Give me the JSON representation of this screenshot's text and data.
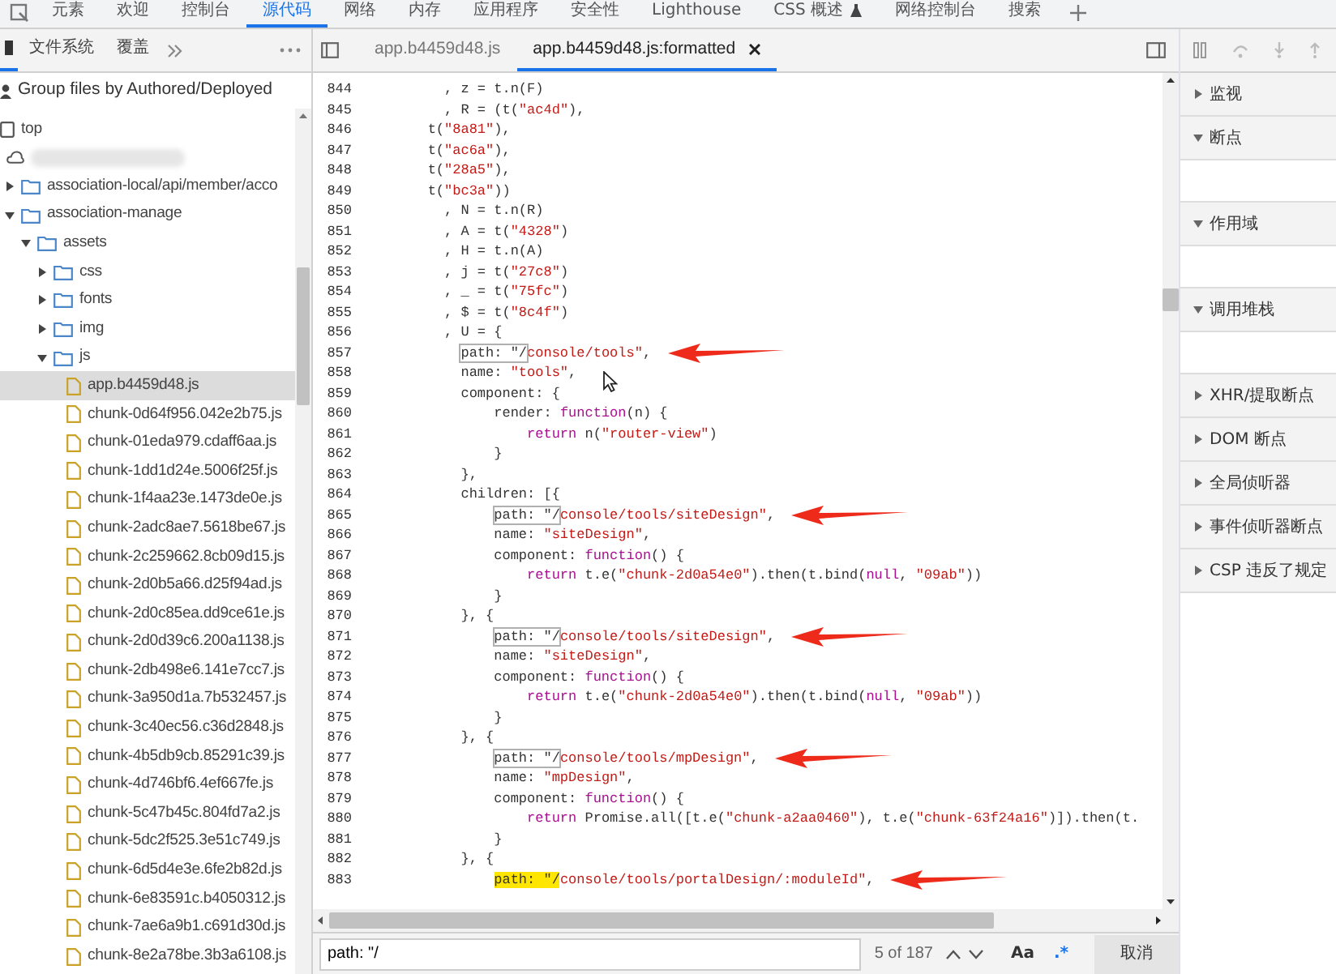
{
  "top_tabs": [
    {
      "label": "元素",
      "selected": false
    },
    {
      "label": "欢迎",
      "selected": false
    },
    {
      "label": "控制台",
      "selected": false
    },
    {
      "label": "源代码",
      "selected": true
    },
    {
      "label": "网络",
      "selected": false
    },
    {
      "label": "内存",
      "selected": false
    },
    {
      "label": "应用程序",
      "selected": false
    },
    {
      "label": "安全性",
      "selected": false
    },
    {
      "label": "Lighthouse",
      "selected": false
    },
    {
      "label": "CSS 概述",
      "selected": false,
      "has_icon": true
    },
    {
      "label": "网络控制台",
      "selected": false
    },
    {
      "label": "搜索",
      "selected": false
    }
  ],
  "navigator": {
    "tabs": [
      {
        "selected": true
      },
      {
        "label": "文件系统",
        "selected": false
      },
      {
        "label": "覆盖",
        "selected": false
      }
    ],
    "group_label": "Group files by Authored/Deployed",
    "tree": [
      {
        "kind": "frame",
        "label": "top",
        "children": [
          {
            "kind": "cloud",
            "children": [
              {
                "kind": "folder",
                "label": "association-local/api/member/acco",
                "expanded": false
              },
              {
                "kind": "folder",
                "label": "association-manage",
                "expanded": true,
                "children": [
                  {
                    "kind": "folder",
                    "label": "assets",
                    "expanded": true,
                    "children": [
                      {
                        "kind": "folder",
                        "label": "css",
                        "expanded": false
                      },
                      {
                        "kind": "folder",
                        "label": "fonts",
                        "expanded": false
                      },
                      {
                        "kind": "folder",
                        "label": "img",
                        "expanded": false
                      },
                      {
                        "kind": "folder",
                        "label": "js",
                        "expanded": true,
                        "children": [
                          {
                            "kind": "file",
                            "label": "app.b4459d48.js",
                            "selected": true
                          },
                          {
                            "kind": "file",
                            "label": "chunk-0d64f956.042e2b75.js",
                            "selected": false
                          },
                          {
                            "kind": "file",
                            "label": "chunk-01eda979.cdaff6aa.js",
                            "selected": false
                          },
                          {
                            "kind": "file",
                            "label": "chunk-1dd1d24e.5006f25f.js",
                            "selected": false
                          },
                          {
                            "kind": "file",
                            "label": "chunk-1f4aa23e.1473de0e.js",
                            "selected": false
                          },
                          {
                            "kind": "file",
                            "label": "chunk-2adc8ae7.5618be67.js",
                            "selected": false
                          },
                          {
                            "kind": "file",
                            "label": "chunk-2c259662.8cb09d15.js",
                            "selected": false
                          },
                          {
                            "kind": "file",
                            "label": "chunk-2d0b5a66.d25f94ad.js",
                            "selected": false
                          },
                          {
                            "kind": "file",
                            "label": "chunk-2d0c85ea.dd9ce61e.js",
                            "selected": false
                          },
                          {
                            "kind": "file",
                            "label": "chunk-2d0d39c6.200a1138.js",
                            "selected": false
                          },
                          {
                            "kind": "file",
                            "label": "chunk-2db498e6.141e7cc7.js",
                            "selected": false
                          },
                          {
                            "kind": "file",
                            "label": "chunk-3a950d1a.7b532457.js",
                            "selected": false
                          },
                          {
                            "kind": "file",
                            "label": "chunk-3c40ec56.c36d2848.js",
                            "selected": false
                          },
                          {
                            "kind": "file",
                            "label": "chunk-4b5db9cb.85291c39.js",
                            "selected": false
                          },
                          {
                            "kind": "file",
                            "label": "chunk-4d746bf6.4ef667fe.js",
                            "selected": false
                          },
                          {
                            "kind": "file",
                            "label": "chunk-5c47b45c.804fd7a2.js",
                            "selected": false
                          },
                          {
                            "kind": "file",
                            "label": "chunk-5dc2f525.3e51c749.js",
                            "selected": false
                          },
                          {
                            "kind": "file",
                            "label": "chunk-6d5d4e3e.6fe2b82d.js",
                            "selected": false
                          },
                          {
                            "kind": "file",
                            "label": "chunk-6e83591c.b4050312.js",
                            "selected": false
                          },
                          {
                            "kind": "file",
                            "label": "chunk-7ae6a9b1.c691d30d.js",
                            "selected": false
                          },
                          {
                            "kind": "file",
                            "label": "chunk-8e2a78be.3b3a6108.js",
                            "selected": false
                          }
                        ]
                      }
                    ]
                  }
                ]
              }
            ]
          }
        ]
      }
    ]
  },
  "editor": {
    "tabs": [
      {
        "label": "app.b4459d48.js",
        "selected": false
      },
      {
        "label": "app.b4459d48.js:formatted",
        "selected": true,
        "closable": true
      }
    ],
    "lines": [
      {
        "num": "844",
        "segs": [
          {
            "kind": "plain",
            "text": "          , z = t.n(F)"
          }
        ]
      },
      {
        "num": "845",
        "segs": [
          {
            "kind": "plain",
            "text": "          , R = (t("
          },
          {
            "kind": "string",
            "text": "\"ac4d\""
          },
          {
            "kind": "plain",
            "text": "),"
          }
        ]
      },
      {
        "num": "846",
        "segs": [
          {
            "kind": "plain",
            "text": "        t("
          },
          {
            "kind": "string",
            "text": "\"8a81\""
          },
          {
            "kind": "plain",
            "text": "),"
          }
        ]
      },
      {
        "num": "847",
        "segs": [
          {
            "kind": "plain",
            "text": "        t("
          },
          {
            "kind": "string",
            "text": "\"ac6a\""
          },
          {
            "kind": "plain",
            "text": "),"
          }
        ]
      },
      {
        "num": "848",
        "segs": [
          {
            "kind": "plain",
            "text": "        t("
          },
          {
            "kind": "string",
            "text": "\"28a5\""
          },
          {
            "kind": "plain",
            "text": "),"
          }
        ]
      },
      {
        "num": "849",
        "segs": [
          {
            "kind": "plain",
            "text": "        t("
          },
          {
            "kind": "string",
            "text": "\"bc3a\""
          },
          {
            "kind": "plain",
            "text": "))"
          }
        ]
      },
      {
        "num": "850",
        "segs": [
          {
            "kind": "plain",
            "text": "          , N = t.n(R)"
          }
        ]
      },
      {
        "num": "851",
        "segs": [
          {
            "kind": "plain",
            "text": "          , A = t("
          },
          {
            "kind": "string",
            "text": "\"4328\""
          },
          {
            "kind": "plain",
            "text": ")"
          }
        ]
      },
      {
        "num": "852",
        "segs": [
          {
            "kind": "plain",
            "text": "          , H = t.n(A)"
          }
        ]
      },
      {
        "num": "853",
        "segs": [
          {
            "kind": "plain",
            "text": "          , j = t("
          },
          {
            "kind": "string",
            "text": "\"27c8\""
          },
          {
            "kind": "plain",
            "text": ")"
          }
        ]
      },
      {
        "num": "854",
        "segs": [
          {
            "kind": "plain",
            "text": "          , _ = t("
          },
          {
            "kind": "string",
            "text": "\"75fc\""
          },
          {
            "kind": "plain",
            "text": ")"
          }
        ]
      },
      {
        "num": "855",
        "segs": [
          {
            "kind": "plain",
            "text": "          , $ = t("
          },
          {
            "kind": "string",
            "text": "\"8c4f\""
          },
          {
            "kind": "plain",
            "text": ")"
          }
        ]
      },
      {
        "num": "856",
        "segs": [
          {
            "kind": "plain",
            "text": "          , U = {"
          }
        ]
      },
      {
        "num": "857",
        "segs": [
          {
            "kind": "match",
            "text": "            path: \"/"
          },
          {
            "kind": "string",
            "text": "console/tools\""
          },
          {
            "kind": "plain",
            "text": ","
          }
        ],
        "arrow": true
      },
      {
        "num": "858",
        "segs": [
          {
            "kind": "plain",
            "text": "            name: "
          },
          {
            "kind": "string",
            "text": "\"tools\""
          },
          {
            "kind": "plain",
            "text": ","
          }
        ],
        "cursor": true
      },
      {
        "num": "859",
        "segs": [
          {
            "kind": "plain",
            "text": "            component: {"
          }
        ]
      },
      {
        "num": "860",
        "segs": [
          {
            "kind": "plain",
            "text": "                render: "
          },
          {
            "kind": "keyword",
            "text": "function"
          },
          {
            "kind": "plain",
            "text": "(n) {"
          }
        ]
      },
      {
        "num": "861",
        "segs": [
          {
            "kind": "keyword",
            "text": "                    return"
          },
          {
            "kind": "plain",
            "text": " n("
          },
          {
            "kind": "string",
            "text": "\"router-view\""
          },
          {
            "kind": "plain",
            "text": ")"
          }
        ]
      },
      {
        "num": "862",
        "segs": [
          {
            "kind": "plain",
            "text": "                }"
          }
        ]
      },
      {
        "num": "863",
        "segs": [
          {
            "kind": "plain",
            "text": "            },"
          }
        ]
      },
      {
        "num": "864",
        "segs": [
          {
            "kind": "plain",
            "text": "            children: [{"
          }
        ]
      },
      {
        "num": "865",
        "segs": [
          {
            "kind": "match",
            "text": "                path: \"/"
          },
          {
            "kind": "string",
            "text": "console/tools/siteDesign\""
          },
          {
            "kind": "plain",
            "text": ","
          }
        ],
        "arrow": true
      },
      {
        "num": "866",
        "segs": [
          {
            "kind": "plain",
            "text": "                name: "
          },
          {
            "kind": "string",
            "text": "\"siteDesign\""
          },
          {
            "kind": "plain",
            "text": ","
          }
        ]
      },
      {
        "num": "867",
        "segs": [
          {
            "kind": "plain",
            "text": "                component: "
          },
          {
            "kind": "keyword",
            "text": "function"
          },
          {
            "kind": "plain",
            "text": "() {"
          }
        ]
      },
      {
        "num": "868",
        "segs": [
          {
            "kind": "keyword",
            "text": "                    return"
          },
          {
            "kind": "plain",
            "text": " t.e("
          },
          {
            "kind": "string",
            "text": "\"chunk-2d0a54e0\""
          },
          {
            "kind": "plain",
            "text": ").then(t.bind("
          },
          {
            "kind": "keyword",
            "text": "null"
          },
          {
            "kind": "plain",
            "text": ", "
          },
          {
            "kind": "string",
            "text": "\"09ab\""
          },
          {
            "kind": "plain",
            "text": "))"
          }
        ]
      },
      {
        "num": "869",
        "segs": [
          {
            "kind": "plain",
            "text": "                }"
          }
        ]
      },
      {
        "num": "870",
        "segs": [
          {
            "kind": "plain",
            "text": "            }, {"
          }
        ]
      },
      {
        "num": "871",
        "segs": [
          {
            "kind": "match",
            "text": "                path: \"/"
          },
          {
            "kind": "string",
            "text": "console/tools/siteDesign\""
          },
          {
            "kind": "plain",
            "text": ","
          }
        ],
        "arrow": true
      },
      {
        "num": "872",
        "segs": [
          {
            "kind": "plain",
            "text": "                name: "
          },
          {
            "kind": "string",
            "text": "\"siteDesign\""
          },
          {
            "kind": "plain",
            "text": ","
          }
        ]
      },
      {
        "num": "873",
        "segs": [
          {
            "kind": "plain",
            "text": "                component: "
          },
          {
            "kind": "keyword",
            "text": "function"
          },
          {
            "kind": "plain",
            "text": "() {"
          }
        ]
      },
      {
        "num": "874",
        "segs": [
          {
            "kind": "keyword",
            "text": "                    return"
          },
          {
            "kind": "plain",
            "text": " t.e("
          },
          {
            "kind": "string",
            "text": "\"chunk-2d0a54e0\""
          },
          {
            "kind": "plain",
            "text": ").then(t.bind("
          },
          {
            "kind": "keyword",
            "text": "null"
          },
          {
            "kind": "plain",
            "text": ", "
          },
          {
            "kind": "string",
            "text": "\"09ab\""
          },
          {
            "kind": "plain",
            "text": "))"
          }
        ]
      },
      {
        "num": "875",
        "segs": [
          {
            "kind": "plain",
            "text": "                }"
          }
        ]
      },
      {
        "num": "876",
        "segs": [
          {
            "kind": "plain",
            "text": "            }, {"
          }
        ]
      },
      {
        "num": "877",
        "segs": [
          {
            "kind": "match",
            "text": "                path: \"/"
          },
          {
            "kind": "string",
            "text": "console/tools/mpDesign\""
          },
          {
            "kind": "plain",
            "text": ","
          }
        ],
        "arrow": true
      },
      {
        "num": "878",
        "segs": [
          {
            "kind": "plain",
            "text": "                name: "
          },
          {
            "kind": "string",
            "text": "\"mpDesign\""
          },
          {
            "kind": "plain",
            "text": ","
          }
        ]
      },
      {
        "num": "879",
        "segs": [
          {
            "kind": "plain",
            "text": "                component: "
          },
          {
            "kind": "keyword",
            "text": "function"
          },
          {
            "kind": "plain",
            "text": "() {"
          }
        ]
      },
      {
        "num": "880",
        "segs": [
          {
            "kind": "keyword",
            "text": "                    return"
          },
          {
            "kind": "plain",
            "text": " Promise.all([t.e("
          },
          {
            "kind": "string",
            "text": "\"chunk-a2aa0460\""
          },
          {
            "kind": "plain",
            "text": "), t.e("
          },
          {
            "kind": "string",
            "text": "\"chunk-63f24a16\""
          },
          {
            "kind": "plain",
            "text": ")]).then(t."
          }
        ]
      },
      {
        "num": "881",
        "segs": [
          {
            "kind": "plain",
            "text": "                }"
          }
        ]
      },
      {
        "num": "882",
        "segs": [
          {
            "kind": "plain",
            "text": "            }, {"
          }
        ]
      },
      {
        "num": "883",
        "segs": [
          {
            "kind": "current",
            "text": "                path: \"/"
          },
          {
            "kind": "string",
            "text": "console/tools/portalDesign/:moduleId\""
          },
          {
            "kind": "plain",
            "text": ","
          }
        ],
        "arrow": true
      }
    ],
    "search": {
      "value": "path: \"/",
      "count": "5 of 187",
      "case_label": "Aa",
      "regex_label": ".*",
      "cancel": "取消"
    }
  },
  "debugger": {
    "sections": [
      {
        "label": "监视",
        "expanded": false
      },
      {
        "label": "断点",
        "expanded": true
      },
      {
        "label": "作用域",
        "expanded": true
      },
      {
        "label": "调用堆栈",
        "expanded": true
      },
      {
        "label": "XHR/提取断点",
        "expanded": false
      },
      {
        "label": "DOM 断点",
        "expanded": false
      },
      {
        "label": "全局侦听器",
        "expanded": false
      },
      {
        "label": "事件侦听器断点",
        "expanded": false
      },
      {
        "label": "CSP 违反了规定",
        "expanded": false
      }
    ]
  }
}
